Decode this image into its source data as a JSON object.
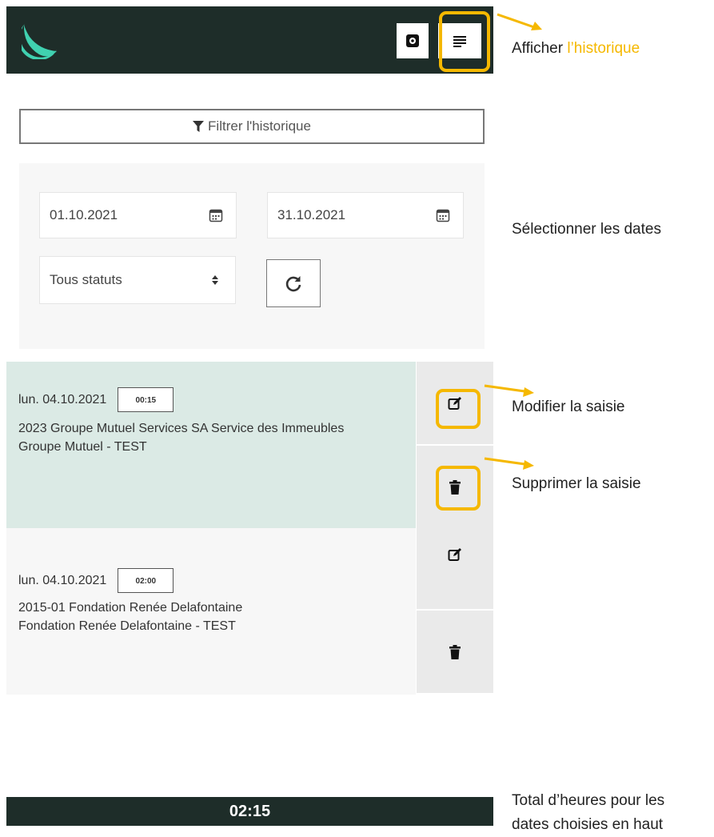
{
  "filter": {
    "label": "Filtrer l'historique"
  },
  "dates": {
    "from": "01.10.2021",
    "to": "31.10.2021"
  },
  "status": {
    "selected": "Tous statuts"
  },
  "entries": [
    {
      "date": "lun. 04.10.2021",
      "duration": "00:15",
      "project": "2023 Groupe Mutuel Services SA Service des Immeubles",
      "client": "Groupe Mutuel - TEST"
    },
    {
      "date": "lun. 04.10.2021",
      "duration": "02:00",
      "project": "2015-01 Fondation Renée Delafontaine",
      "client": "Fondation Renée Delafontaine - TEST"
    }
  ],
  "footer": {
    "total": "02:15"
  },
  "annotations": {
    "history_prefix": "Afficher ",
    "history_accent": "l’historique",
    "dates": "Sélectionner les dates",
    "edit": "Modifier la saisie",
    "delete": "Supprimer la saisie",
    "total_line1": "Total d’heures pour les",
    "total_line2": "dates choisies en haut"
  },
  "colors": {
    "brand": "#40d1b0",
    "dark": "#1e2d29",
    "highlight": "#f5b800",
    "selected_row": "#dbeae5"
  },
  "icons": [
    "logo-icon",
    "settings-icon",
    "menu-icon",
    "filter-icon",
    "calendar-icon",
    "sort-icon",
    "refresh-icon",
    "edit-icon",
    "trash-icon"
  ]
}
